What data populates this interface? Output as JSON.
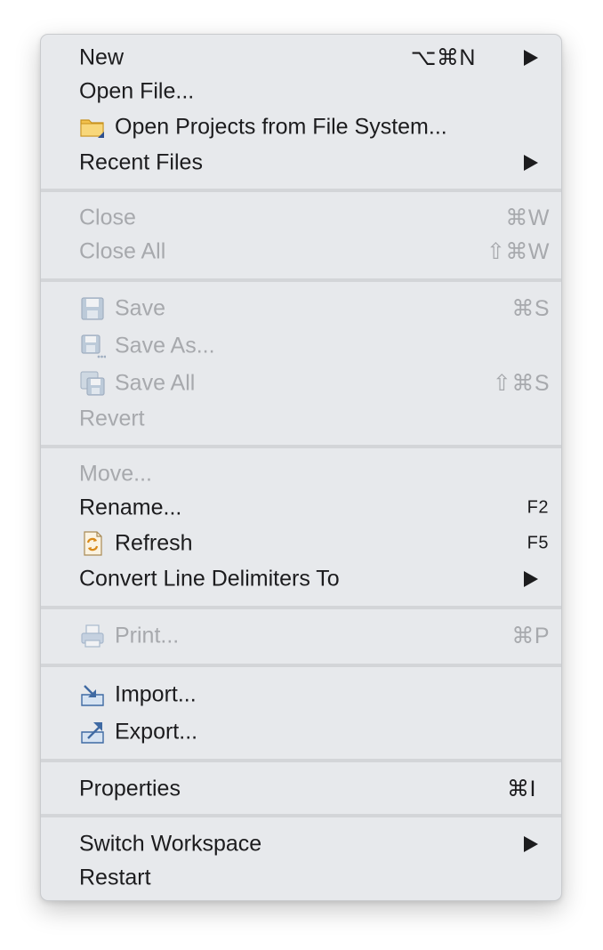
{
  "menu": {
    "new": {
      "label": "New",
      "shortcut": "⌥⌘N"
    },
    "open_file": {
      "label": "Open File..."
    },
    "open_projects": {
      "label": "Open Projects from File System...",
      "icon": "folder-icon"
    },
    "recent_files": {
      "label": "Recent Files"
    },
    "close": {
      "label": "Close",
      "shortcut": "⌘W"
    },
    "close_all": {
      "label": "Close All",
      "shortcut": "⇧⌘W"
    },
    "save": {
      "label": "Save",
      "shortcut": "⌘S",
      "icon": "save-icon"
    },
    "save_as": {
      "label": "Save As...",
      "icon": "save-as-icon"
    },
    "save_all": {
      "label": "Save All",
      "shortcut": "⇧⌘S",
      "icon": "save-all-icon"
    },
    "revert": {
      "label": "Revert"
    },
    "move": {
      "label": "Move..."
    },
    "rename": {
      "label": "Rename...",
      "shortcut": "F2"
    },
    "refresh": {
      "label": "Refresh",
      "shortcut": "F5",
      "icon": "refresh-icon"
    },
    "convert_line_delimiters": {
      "label": "Convert Line Delimiters To"
    },
    "print": {
      "label": "Print...",
      "shortcut": "⌘P",
      "icon": "printer-icon"
    },
    "import": {
      "label": "Import...",
      "icon": "import-icon"
    },
    "export": {
      "label": "Export...",
      "icon": "export-icon"
    },
    "properties": {
      "label": "Properties",
      "shortcut": "⌘I"
    },
    "switch_workspace": {
      "label": "Switch Workspace"
    },
    "restart": {
      "label": "Restart"
    }
  },
  "colors": {
    "menu_background": "#e7e9ec",
    "text_enabled": "#1c1c1e",
    "text_disabled": "#a7a9ad",
    "separator": "#d3d5d8"
  }
}
